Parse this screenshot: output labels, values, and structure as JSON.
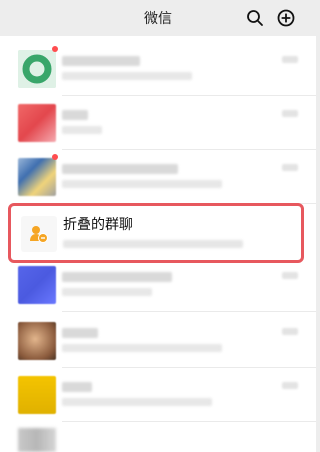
{
  "header": {
    "title": "微信",
    "icons": [
      "search-icon",
      "add-circle-icon"
    ]
  },
  "chat_list": {
    "folded_group": {
      "title": "折叠的群聊",
      "icon": "group-chat-icon",
      "accent": "#f5a524",
      "highlight_color": "#e7585e"
    }
  }
}
